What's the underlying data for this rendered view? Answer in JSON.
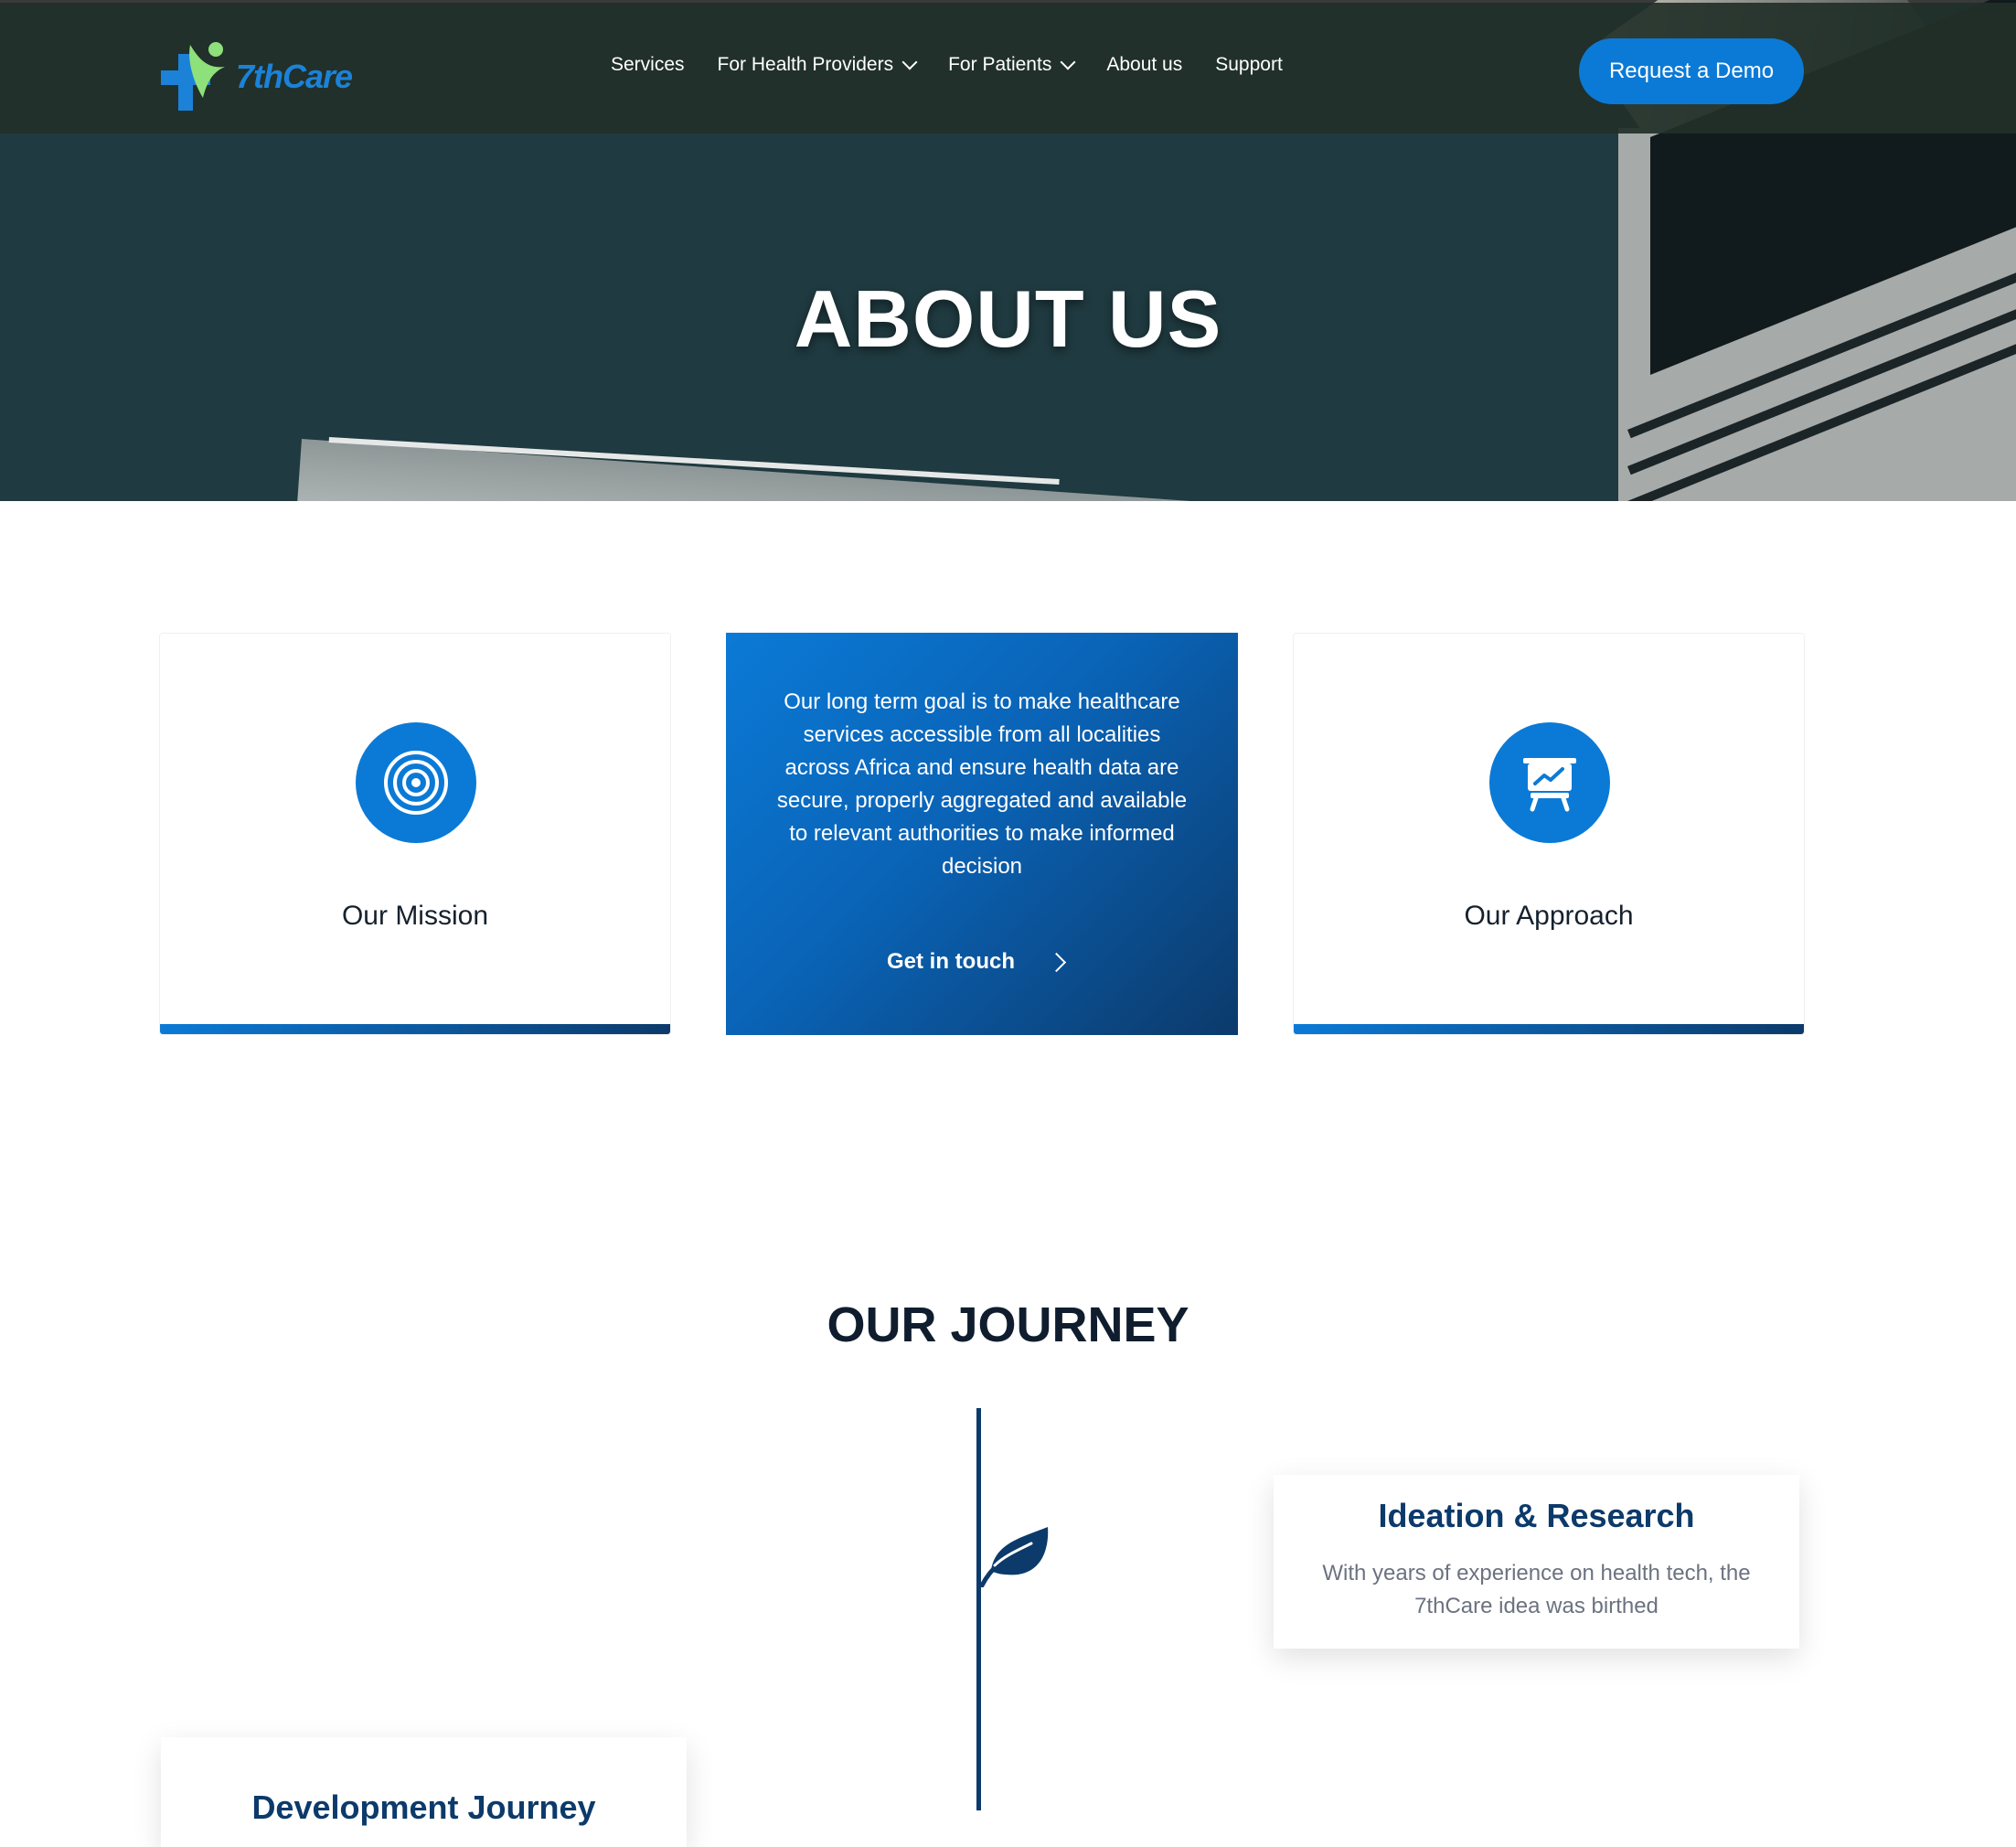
{
  "brand": {
    "name": "7thCare"
  },
  "nav": {
    "items": [
      {
        "label": "Services",
        "has_dropdown": false
      },
      {
        "label": "For Health Providers",
        "has_dropdown": true
      },
      {
        "label": "For Patients",
        "has_dropdown": true
      },
      {
        "label": "About us",
        "has_dropdown": false
      },
      {
        "label": "Support",
        "has_dropdown": false
      }
    ],
    "cta_label": "Request a Demo"
  },
  "hero": {
    "title": "ABOUT US"
  },
  "cards": {
    "mission": {
      "title": "Our Mission",
      "icon": "target-icon"
    },
    "vision": {
      "text": "Our long term goal is to make healthcare services accessible from all localities across Africa and ensure health data are secure, properly aggregated and available to relevant authorities to make informed decision",
      "link_label": "Get in touch"
    },
    "approach": {
      "title": "Our Approach",
      "icon": "presentation-chart-icon"
    }
  },
  "journey": {
    "title": "OUR JOURNEY",
    "items": [
      {
        "title": "Ideation & Research",
        "text": "With years of experience on health tech, the 7thCare idea was birthed",
        "icon": "leaf-icon"
      },
      {
        "title": "Development Journey"
      }
    ]
  },
  "colors": {
    "primary": "#0b7ad6",
    "navy": "#0c3a6b",
    "hero_overlay": "#1f3a40",
    "logo_green": "#8ee07a"
  }
}
